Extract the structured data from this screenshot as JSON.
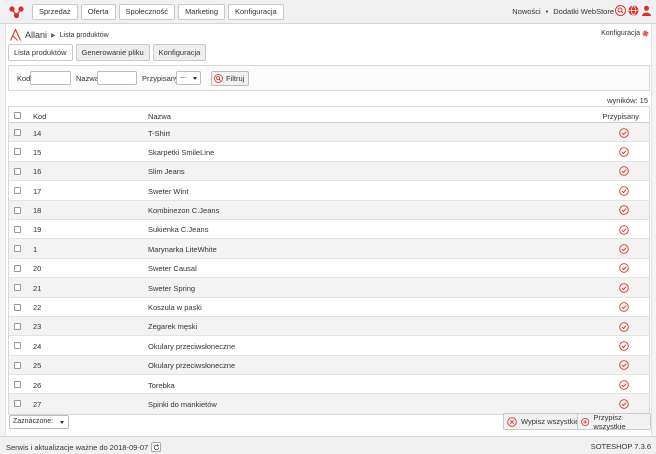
{
  "nav": {
    "items": [
      "Sprzedaż",
      "Oferta",
      "Społeczność",
      "Marketing",
      "Konfiguracja"
    ],
    "links": [
      "Nowości",
      "Dodatki WebStore"
    ]
  },
  "breadcrumb": {
    "root": "Allani",
    "current": "Lista produktów"
  },
  "header": {
    "config_link": "Konfiguracja"
  },
  "tabs": [
    "Lista produktów",
    "Generowanie pliku",
    "Konfiguracja"
  ],
  "filter": {
    "kod_label": "Kod",
    "nazwa_label": "Nazwa",
    "przypisany_label": "Przypisany",
    "przypisany_value": "---",
    "button": "Filtruj"
  },
  "results": "wyników: 15",
  "table": {
    "headers": {
      "kod": "Kod",
      "nazwa": "Nazwa",
      "przypisany": "Przypisany"
    },
    "rows": [
      {
        "kod": "14",
        "nazwa": "T-Shirt"
      },
      {
        "kod": "15",
        "nazwa": "Skarpetki SmileLine"
      },
      {
        "kod": "16",
        "nazwa": "Slim Jeans"
      },
      {
        "kod": "17",
        "nazwa": "Sweter Wint"
      },
      {
        "kod": "18",
        "nazwa": "Kombinezon C.Jeans"
      },
      {
        "kod": "19",
        "nazwa": "Sukienka C.Jeans"
      },
      {
        "kod": "1",
        "nazwa": "Marynarka LiteWhite"
      },
      {
        "kod": "20",
        "nazwa": "Sweter Causal"
      },
      {
        "kod": "21",
        "nazwa": "Sweter Spring"
      },
      {
        "kod": "22",
        "nazwa": "Koszula w paski"
      },
      {
        "kod": "23",
        "nazwa": "Zegarek męski"
      },
      {
        "kod": "24",
        "nazwa": "Okulary przeciwsłoneczne"
      },
      {
        "kod": "25",
        "nazwa": "Okulary przeciwsłoneczne"
      },
      {
        "kod": "26",
        "nazwa": "Torebka"
      },
      {
        "kod": "27",
        "nazwa": "Spinki do mankietów"
      }
    ]
  },
  "bulk": {
    "select_label": "Zaznaczone:",
    "unassign_all": "Wypisz wszystkie",
    "assign_all": "Przypisz wszystkie"
  },
  "footer": {
    "service": "Serwis i aktualizacje ważne do 2018-09-07",
    "version": "SOTESHOP 7.3.6"
  },
  "colors": {
    "accent": "#d9302c",
    "border": "#c9c9c9"
  }
}
